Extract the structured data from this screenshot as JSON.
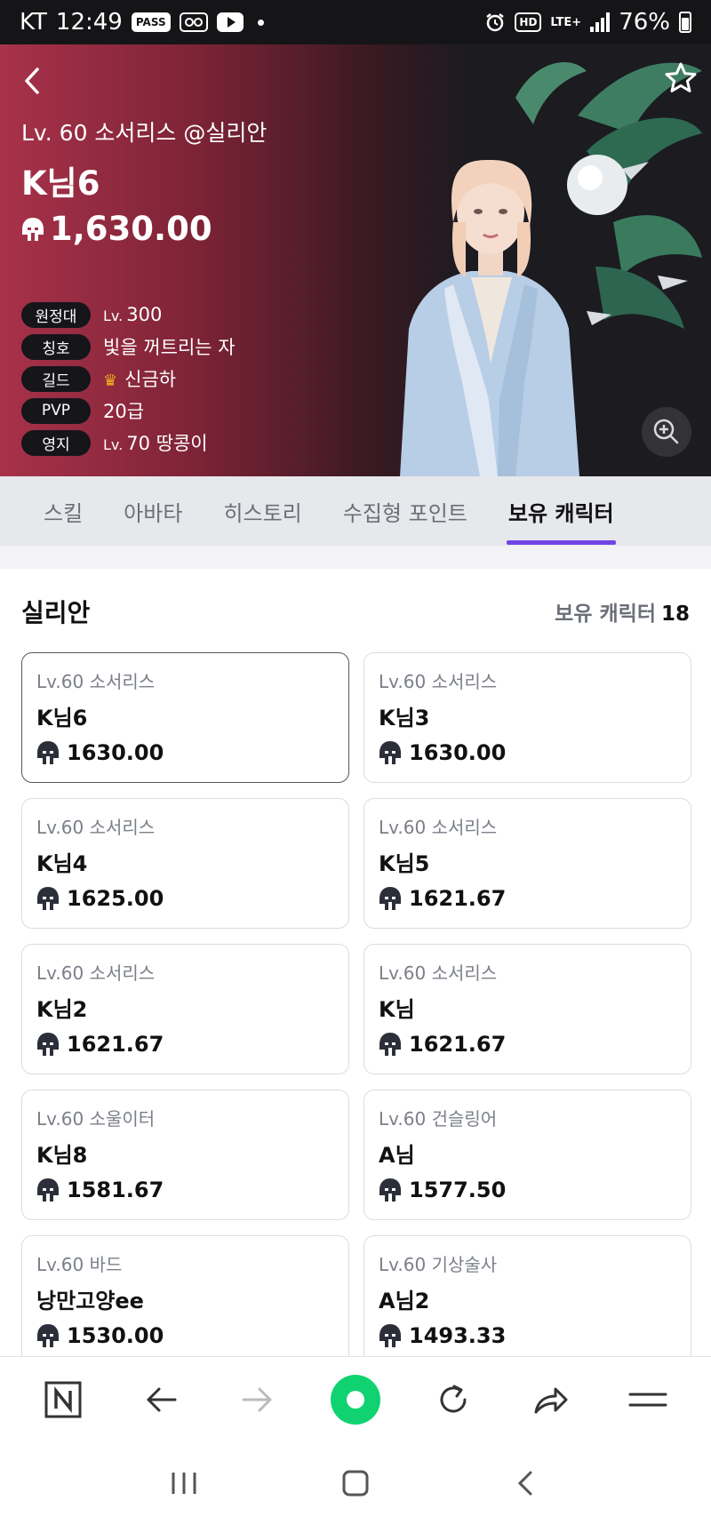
{
  "status_bar": {
    "carrier": "KT",
    "time": "12:49",
    "pass_label": "PASS",
    "network": "LTE+",
    "hd_label": "HD",
    "battery": "76%"
  },
  "hero": {
    "subtitle": "Lv. 60 소서리스 @실리안",
    "name": "K님6",
    "power": "1,630.00",
    "info": [
      {
        "label": "원정대",
        "prefix": "Lv.",
        "value": "300"
      },
      {
        "label": "칭호",
        "prefix": "",
        "value": "빛을 꺼트리는 자"
      },
      {
        "label": "길드",
        "prefix": "",
        "value": "신금하",
        "icon": "crown-icon"
      },
      {
        "label": "PVP",
        "prefix": "",
        "value": "20급"
      },
      {
        "label": "영지",
        "prefix": "Lv.",
        "value": "70 땅콩이"
      }
    ]
  },
  "tabs": [
    {
      "label": "스킬",
      "active": false
    },
    {
      "label": "아바타",
      "active": false
    },
    {
      "label": "히스토리",
      "active": false
    },
    {
      "label": "수집형 포인트",
      "active": false
    },
    {
      "label": "보유 캐릭터",
      "active": true
    }
  ],
  "section": {
    "server": "실리안",
    "count_label": "보유 캐릭터",
    "count": "18"
  },
  "characters": [
    {
      "class": "Lv.60 소서리스",
      "name": "K님6",
      "power": "1630.00",
      "selected": true
    },
    {
      "class": "Lv.60 소서리스",
      "name": "K님3",
      "power": "1630.00",
      "selected": false
    },
    {
      "class": "Lv.60 소서리스",
      "name": "K님4",
      "power": "1625.00",
      "selected": false
    },
    {
      "class": "Lv.60 소서리스",
      "name": "K님5",
      "power": "1621.67",
      "selected": false
    },
    {
      "class": "Lv.60 소서리스",
      "name": "K님2",
      "power": "1621.67",
      "selected": false
    },
    {
      "class": "Lv.60 소서리스",
      "name": "K님",
      "power": "1621.67",
      "selected": false
    },
    {
      "class": "Lv.60 소울이터",
      "name": "K님8",
      "power": "1581.67",
      "selected": false
    },
    {
      "class": "Lv.60 건슬링어",
      "name": "A님",
      "power": "1577.50",
      "selected": false
    },
    {
      "class": "Lv.60 바드",
      "name": "낭만고양ee",
      "power": "1530.00",
      "selected": false
    },
    {
      "class": "Lv.60 기상술사",
      "name": "A님2",
      "power": "1493.33",
      "selected": false
    }
  ],
  "browser_bar": {
    "icons": [
      "naver-n-icon",
      "back-arrow-icon",
      "forward-arrow-icon",
      "home-icon",
      "refresh-icon",
      "share-icon",
      "menu-icon"
    ]
  },
  "nav_bar": {
    "icons": [
      "recent-apps-icon",
      "home-square-icon",
      "back-chevron-icon"
    ]
  },
  "colors": {
    "accent": "#7145e6",
    "hero_start": "#a8324a",
    "home_green": "#10d270"
  }
}
